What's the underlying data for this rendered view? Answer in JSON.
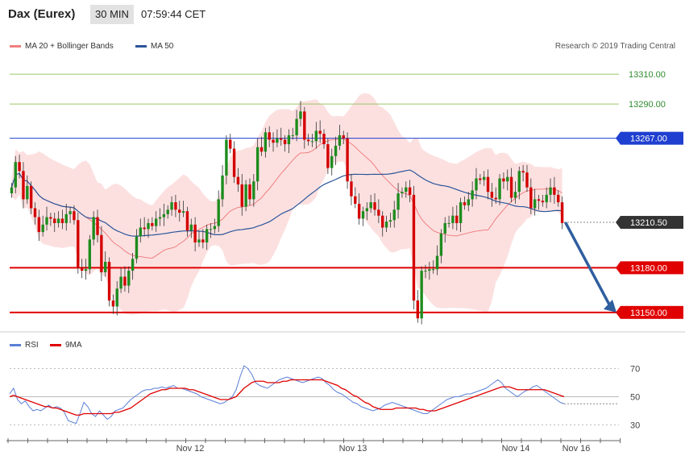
{
  "header": {
    "symbol": "Dax (Eurex)",
    "interval": "30 MIN",
    "time": "07:59:44 CET"
  },
  "legend": {
    "ma20_label": "MA 20 + Bollinger Bands",
    "ma50_label": "MA 50",
    "credit": "Research © 2019 Trading Central"
  },
  "rsi_legend": {
    "rsi_label": "RSI",
    "ma_label": "9MA"
  },
  "colors": {
    "up": "#1e8c1e",
    "down": "#d40000",
    "band_fill": "#fbdada",
    "ma20": "#f08080",
    "ma50": "#2a5599",
    "resistance": "#1e3fd0",
    "support": "#e00000",
    "target": "#9ac766",
    "price_box": "#333333",
    "arrow": "#2e5e9e",
    "rsi": "#5b7fd6",
    "rsi_ma": "#e00000"
  },
  "chart_data": [
    {
      "type": "candlestick",
      "title": "Dax (Eurex) 30 MIN",
      "x_ticks": [
        "Nov 12",
        "Nov 13",
        "Nov 14",
        "Nov 16"
      ],
      "ylim": [
        13138,
        13322
      ],
      "levels": [
        {
          "value": 13310.0,
          "label": "13310.00",
          "kind": "target"
        },
        {
          "value": 13290.0,
          "label": "13290.00",
          "kind": "target"
        },
        {
          "value": 13267.0,
          "label": "13267.00",
          "kind": "resistance"
        },
        {
          "value": 13210.5,
          "label": "13210.50",
          "kind": "last"
        },
        {
          "value": 13180.0,
          "label": "13180.00",
          "kind": "support"
        },
        {
          "value": 13150.0,
          "label": "13150.00",
          "kind": "support"
        }
      ],
      "projection": {
        "from_value": 13210.5,
        "to_value": 13150.0
      },
      "closes": [
        13234,
        13251,
        13245,
        13226,
        13235,
        13220,
        13214,
        13204,
        13209,
        13214,
        13213,
        13210,
        13213,
        13210,
        13216,
        13218,
        13212,
        13180,
        13178,
        13179,
        13199,
        13214,
        13202,
        13177,
        13184,
        13158,
        13154,
        13166,
        13174,
        13168,
        13178,
        13186,
        13201,
        13207,
        13206,
        13210,
        13208,
        13213,
        13214,
        13216,
        13219,
        13224,
        13219,
        13217,
        13218,
        13205,
        13209,
        13197,
        13199,
        13197,
        13206,
        13206,
        13208,
        13226,
        13242,
        13266,
        13260,
        13241,
        13236,
        13221,
        13236,
        13226,
        13238,
        13261,
        13258,
        13271,
        13266,
        13264,
        13267,
        13266,
        13263,
        13269,
        13269,
        13280,
        13285,
        13266,
        13265,
        13265,
        13272,
        13270,
        13263,
        13247,
        13255,
        13262,
        13269,
        13267,
        13238,
        13228,
        13223,
        13213,
        13218,
        13220,
        13224,
        13219,
        13215,
        13207,
        13211,
        13212,
        13219,
        13230,
        13231,
        13234,
        13229,
        13158,
        13146,
        13178,
        13178,
        13179,
        13179,
        13188,
        13203,
        13210,
        13210,
        13215,
        13210,
        13224,
        13222,
        13226,
        13232,
        13240,
        13239,
        13241,
        13231,
        13227,
        13226,
        13240,
        13238,
        13241,
        13227,
        13231,
        13245,
        13244,
        13234,
        13220,
        13226,
        13225,
        13224,
        13229,
        13234,
        13229,
        13224,
        13210
      ],
      "opens_up_first": true
    },
    {
      "type": "line",
      "title": "RSI",
      "ylim": [
        20,
        80
      ],
      "yticks": [
        30,
        50,
        70
      ],
      "series": [
        {
          "name": "RSI",
          "values": [
            52,
            56,
            48,
            45,
            47,
            43,
            40,
            41,
            40,
            42,
            44,
            42,
            43,
            42,
            39,
            33,
            32,
            31,
            38,
            46,
            43,
            38,
            36,
            40,
            37,
            34,
            36,
            40,
            41,
            42,
            45,
            48,
            50,
            52,
            54,
            55,
            55,
            56,
            56,
            57,
            56,
            57,
            58,
            56,
            56,
            55,
            54,
            53,
            52,
            50,
            49,
            48,
            47,
            46,
            45,
            46,
            48,
            50,
            55,
            64,
            72,
            70,
            66,
            60,
            58,
            57,
            56,
            58,
            60,
            62,
            63,
            64,
            63,
            62,
            61,
            60,
            61,
            62,
            63,
            64,
            63,
            60,
            58,
            55,
            53,
            52,
            50,
            48,
            46,
            45,
            43,
            42,
            41,
            40,
            41,
            42,
            44,
            45,
            46,
            45,
            44,
            43,
            42,
            41,
            40,
            39,
            38,
            38,
            40,
            42,
            44,
            46,
            48,
            49,
            50,
            50,
            51,
            52,
            52,
            53,
            54,
            55,
            56,
            58,
            60,
            62,
            60,
            56,
            54,
            52,
            50,
            52,
            54,
            55,
            57,
            58,
            56,
            54,
            52,
            50,
            48,
            46,
            45
          ]
        },
        {
          "name": "9MA",
          "values": [
            50,
            51,
            50,
            49,
            48,
            47,
            46,
            45,
            44,
            43,
            43,
            42,
            42,
            41,
            40,
            39,
            38,
            37,
            37,
            38,
            38,
            38,
            38,
            38,
            38,
            38,
            38,
            39,
            39,
            40,
            41,
            42,
            44,
            46,
            48,
            50,
            52,
            53,
            54,
            55,
            55,
            56,
            56,
            56,
            56,
            56,
            55,
            55,
            54,
            53,
            52,
            51,
            50,
            49,
            48,
            48,
            48,
            49,
            50,
            53,
            56,
            58,
            60,
            61,
            61,
            61,
            60,
            60,
            60,
            60,
            61,
            61,
            62,
            62,
            62,
            62,
            62,
            62,
            62,
            62,
            62,
            61,
            60,
            59,
            58,
            56,
            55,
            53,
            51,
            50,
            48,
            46,
            45,
            43,
            42,
            41,
            41,
            41,
            41,
            42,
            42,
            42,
            42,
            42,
            42,
            41,
            41,
            40,
            40,
            40,
            41,
            42,
            43,
            44,
            45,
            46,
            47,
            48,
            49,
            50,
            51,
            52,
            53,
            54,
            55,
            56,
            57,
            57,
            57,
            56,
            55,
            55,
            55,
            55,
            55,
            55,
            55,
            55,
            54,
            53,
            52,
            51,
            50
          ]
        }
      ]
    }
  ]
}
